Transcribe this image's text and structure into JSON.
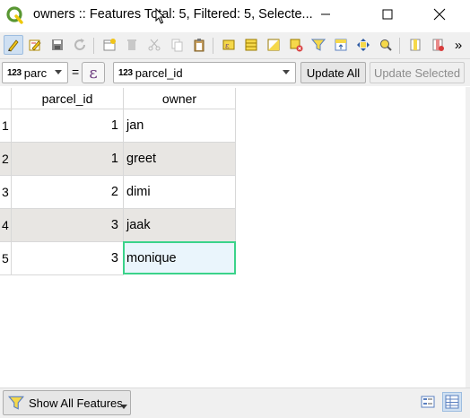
{
  "window": {
    "title": "owners :: Features Total: 5, Filtered: 5, Selecte...",
    "minimize_icon": "minimize-icon",
    "maximize_icon": "maximize-icon",
    "close_icon": "close-icon"
  },
  "toolbar": {
    "icons": [
      "toggle-editing-icon",
      "multi-edit-icon",
      "save-edits-icon",
      "reload-icon",
      "add-feature-icon",
      "delete-feature-icon",
      "cut-icon",
      "copy-icon",
      "paste-icon",
      "expression-select-icon",
      "select-all-icon",
      "invert-selection-icon",
      "deselect-icon",
      "filter-icon",
      "move-selection-top-icon",
      "pan-to-selection-icon",
      "zoom-to-selection-icon",
      "new-field-icon",
      "delete-field-icon",
      "more-icon"
    ],
    "overflow_label": "»"
  },
  "expression_bar": {
    "field_type_badge": "123",
    "field_short_label": "parc",
    "equals_label": "=",
    "epsilon_label": "ε",
    "field_badge": "123",
    "field_value": "parcel_id",
    "update_all_label": "Update All",
    "update_selected_label": "Update Selected"
  },
  "table": {
    "columns": [
      "parcel_id",
      "owner"
    ],
    "rows": [
      {
        "num": "1",
        "parcel_id": "1",
        "owner": "jan"
      },
      {
        "num": "2",
        "parcel_id": "1",
        "owner": "greet"
      },
      {
        "num": "3",
        "parcel_id": "2",
        "owner": "dimi"
      },
      {
        "num": "4",
        "parcel_id": "3",
        "owner": "jaak"
      },
      {
        "num": "5",
        "parcel_id": "3",
        "owner": "monique"
      }
    ]
  },
  "bottom": {
    "show_all_label": "Show All Features",
    "form_view_icon": "form-view-icon",
    "table_view_icon": "table-view-icon"
  },
  "colors": {
    "focus_border": "#3bd38a",
    "alt_row": "#e8e6e3",
    "qgis_green": "#589632",
    "qgis_yellow": "#eec80a"
  }
}
